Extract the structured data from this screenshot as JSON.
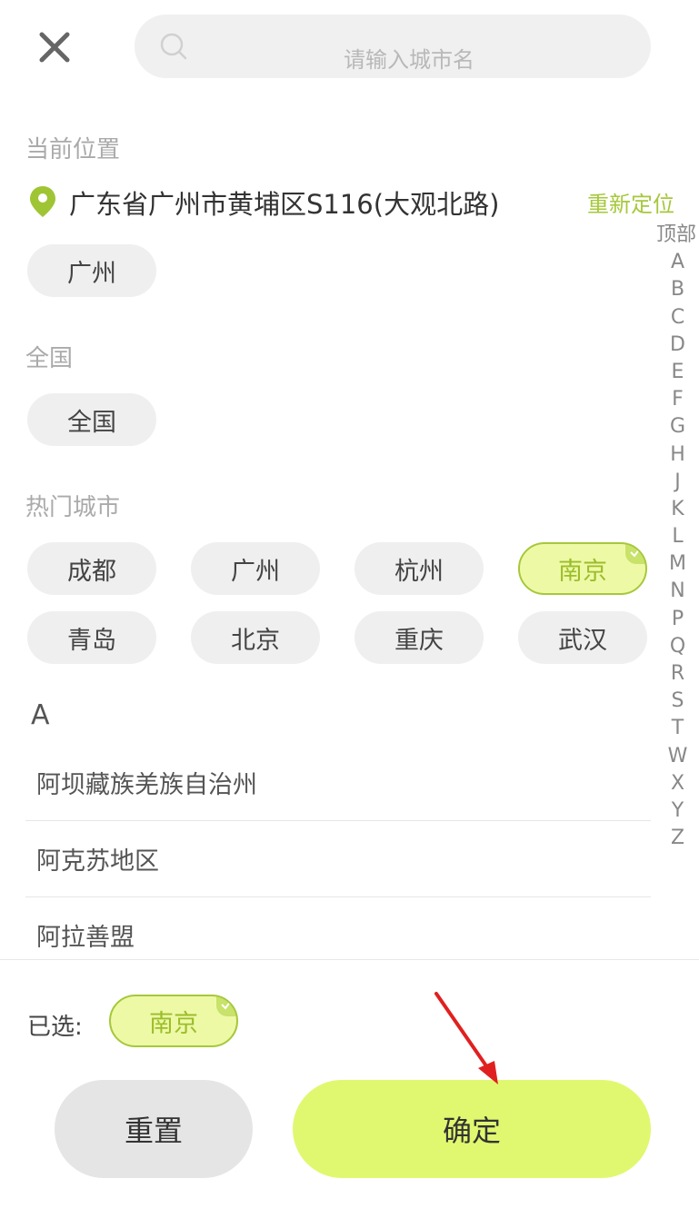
{
  "header": {
    "search_placeholder": "请输入城市名"
  },
  "current_location": {
    "title": "当前位置",
    "address": "广东省广州市黄埔区S116(大观北路)",
    "relocate_label": "重新定位",
    "city_chip": "广州"
  },
  "nationwide": {
    "title": "全国",
    "chip": "全国"
  },
  "hot_cities": {
    "title": "热门城市",
    "items": [
      "成都",
      "广州",
      "杭州",
      "南京",
      "青岛",
      "北京",
      "重庆",
      "武汉"
    ],
    "selected": "南京"
  },
  "city_list": {
    "letter": "A",
    "items": [
      "阿坝藏族羌族自治州",
      "阿克苏地区",
      "阿拉善盟"
    ]
  },
  "index_bar": [
    "顶部",
    "A",
    "B",
    "C",
    "D",
    "E",
    "F",
    "G",
    "H",
    "J",
    "K",
    "L",
    "M",
    "N",
    "P",
    "Q",
    "R",
    "S",
    "T",
    "W",
    "X",
    "Y",
    "Z"
  ],
  "footer": {
    "selected_label": "已选:",
    "selected_city": "南京",
    "reset_label": "重置",
    "confirm_label": "确定"
  },
  "colors": {
    "accent": "#a6c83c",
    "selected_bg": "#eef9a6",
    "confirm_bg": "#e0f86f",
    "annotation_arrow": "#e02020"
  }
}
